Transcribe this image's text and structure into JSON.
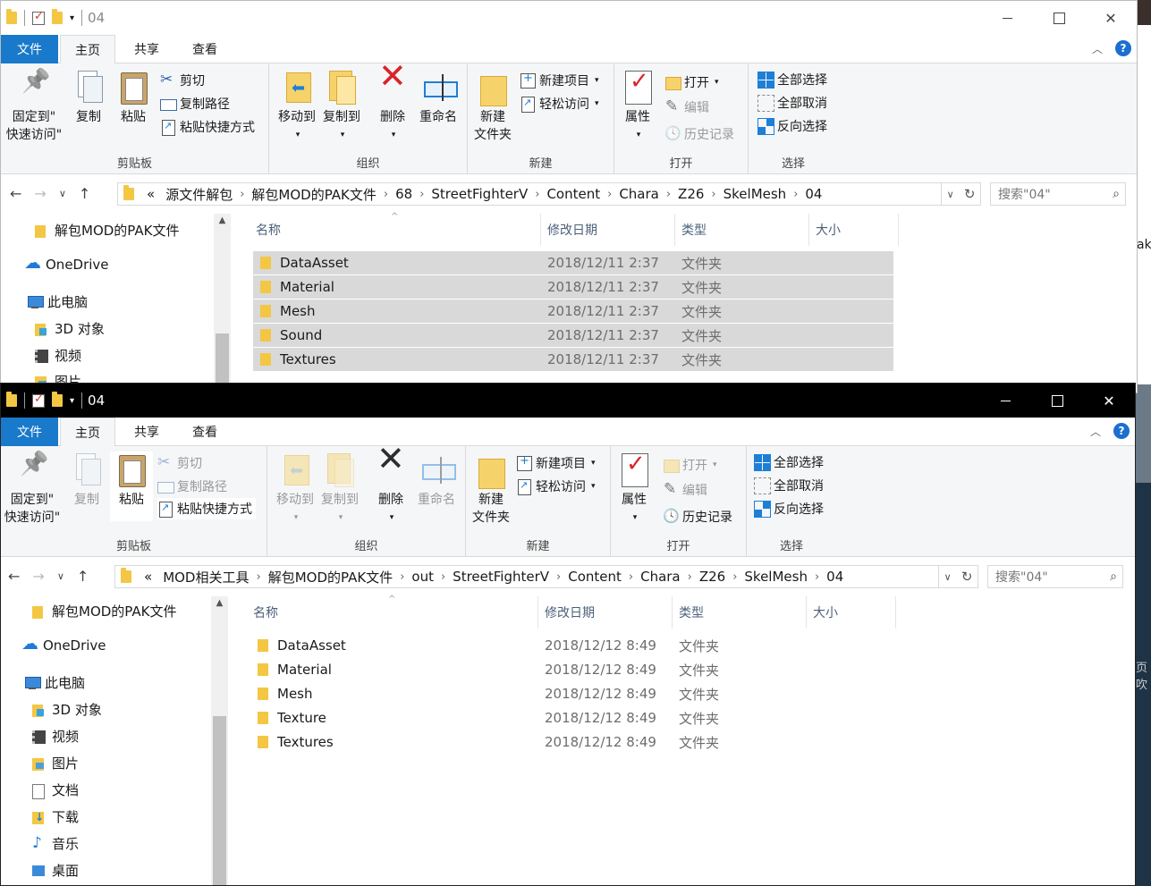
{
  "windows": [
    {
      "title": "04",
      "tabs": {
        "file": "文件",
        "home": "主页",
        "share": "共享",
        "view": "查看"
      },
      "ribbon": {
        "clipboard": {
          "label": "剪贴板",
          "pin": "固定到\"\n快速访问\"",
          "copy": "复制",
          "paste": "粘贴",
          "cut": "剪切",
          "copy_path": "复制路径",
          "paste_shortcut": "粘贴快捷方式"
        },
        "organize": {
          "label": "组织",
          "move_to": "移动到",
          "copy_to": "复制到",
          "delete": "删除",
          "rename": "重命名"
        },
        "new": {
          "label": "新建",
          "new_folder": "新建\n文件夹",
          "new_item": "新建项目",
          "easy_access": "轻松访问"
        },
        "open": {
          "label": "打开",
          "properties": "属性",
          "open": "打开",
          "edit": "编辑",
          "history": "历史记录"
        },
        "select": {
          "label": "选择",
          "select_all": "全部选择",
          "select_none": "全部取消",
          "invert": "反向选择"
        }
      },
      "breadcrumb": [
        "«",
        "源文件解包",
        "解包MOD的PAK文件",
        "68",
        "StreetFighterV",
        "Content",
        "Chara",
        "Z26",
        "SkelMesh",
        "04"
      ],
      "search_placeholder": "搜索\"04\"",
      "nav": [
        "解包MOD的PAK文件",
        "OneDrive",
        "此电脑",
        "3D 对象",
        "视频",
        "图片"
      ],
      "columns": {
        "name": "名称",
        "date": "修改日期",
        "type": "类型",
        "size": "大小"
      },
      "files": [
        {
          "name": "DataAsset",
          "date": "2018/12/11 2:37",
          "type": "文件夹"
        },
        {
          "name": "Material",
          "date": "2018/12/11 2:37",
          "type": "文件夹"
        },
        {
          "name": "Mesh",
          "date": "2018/12/11 2:37",
          "type": "文件夹"
        },
        {
          "name": "Sound",
          "date": "2018/12/11 2:37",
          "type": "文件夹"
        },
        {
          "name": "Textures",
          "date": "2018/12/11 2:37",
          "type": "文件夹"
        }
      ]
    },
    {
      "title": "04",
      "tabs": {
        "file": "文件",
        "home": "主页",
        "share": "共享",
        "view": "查看"
      },
      "ribbon": {
        "clipboard": {
          "label": "剪贴板",
          "pin": "固定到\"\n快速访问\"",
          "copy": "复制",
          "paste": "粘贴",
          "cut": "剪切",
          "copy_path": "复制路径",
          "paste_shortcut": "粘贴快捷方式"
        },
        "organize": {
          "label": "组织",
          "move_to": "移动到",
          "copy_to": "复制到",
          "delete": "删除",
          "rename": "重命名"
        },
        "new": {
          "label": "新建",
          "new_folder": "新建\n文件夹",
          "new_item": "新建项目",
          "easy_access": "轻松访问"
        },
        "open": {
          "label": "打开",
          "properties": "属性",
          "open": "打开",
          "edit": "编辑",
          "history": "历史记录"
        },
        "select": {
          "label": "选择",
          "select_all": "全部选择",
          "select_none": "全部取消",
          "invert": "反向选择"
        }
      },
      "breadcrumb": [
        "«",
        "MOD相关工具",
        "解包MOD的PAK文件",
        "out",
        "StreetFighterV",
        "Content",
        "Chara",
        "Z26",
        "SkelMesh",
        "04"
      ],
      "search_placeholder": "搜索\"04\"",
      "nav": [
        "解包MOD的PAK文件",
        "OneDrive",
        "此电脑",
        "3D 对象",
        "视频",
        "图片",
        "文档",
        "下载",
        "音乐",
        "桌面"
      ],
      "columns": {
        "name": "名称",
        "date": "修改日期",
        "type": "类型",
        "size": "大小"
      },
      "files": [
        {
          "name": "DataAsset",
          "date": "2018/12/12 8:49",
          "type": "文件夹"
        },
        {
          "name": "Material",
          "date": "2018/12/12 8:49",
          "type": "文件夹"
        },
        {
          "name": "Mesh",
          "date": "2018/12/12 8:49",
          "type": "文件夹"
        },
        {
          "name": "Texture",
          "date": "2018/12/12 8:49",
          "type": "文件夹"
        },
        {
          "name": "Textures",
          "date": "2018/12/12 8:49",
          "type": "文件夹"
        }
      ]
    }
  ],
  "background_text": [
    "ak",
    "页吹"
  ],
  "colors": {
    "accent": "#1979ca",
    "selection": "#d9d9d9",
    "folder": "#f3c744",
    "active_titlebar": "#000000"
  }
}
